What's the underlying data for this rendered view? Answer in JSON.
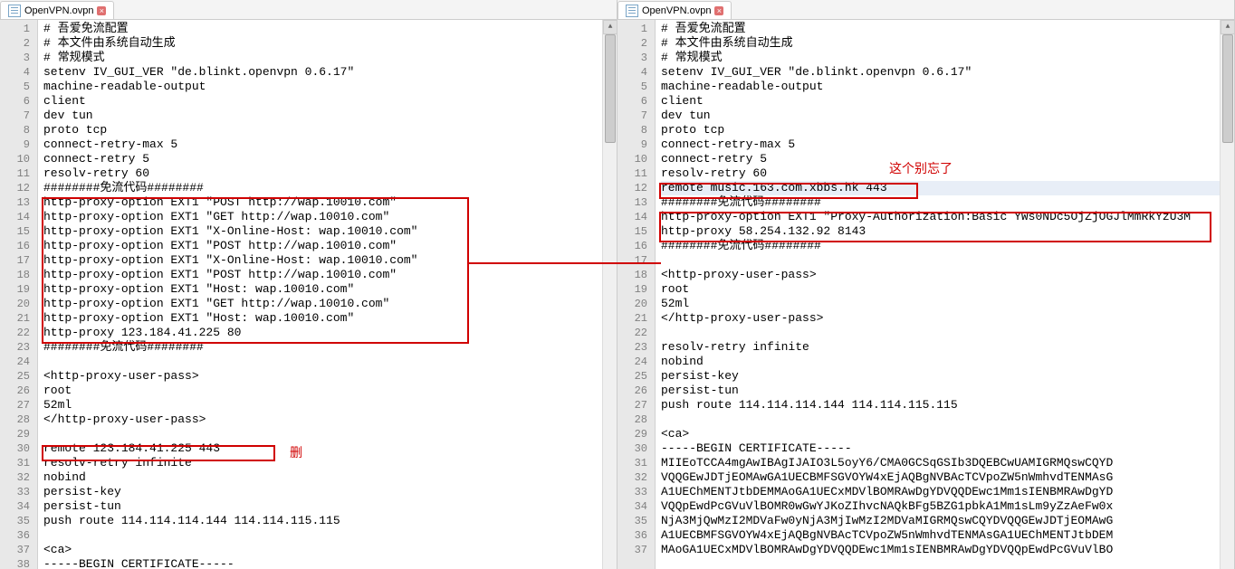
{
  "left": {
    "tab_label": "OpenVPN.ovpn",
    "lines": [
      "# 吾爱免流配置",
      "# 本文件由系统自动生成",
      "# 常规模式",
      "setenv IV_GUI_VER \"de.blinkt.openvpn 0.6.17\"",
      "machine-readable-output",
      "client",
      "dev tun",
      "proto tcp",
      "connect-retry-max 5",
      "connect-retry 5",
      "resolv-retry 60",
      "########免流代码########",
      "http-proxy-option EXT1 \"POST http://wap.10010.com\"",
      "http-proxy-option EXT1 \"GET http://wap.10010.com\"",
      "http-proxy-option EXT1 \"X-Online-Host: wap.10010.com\"",
      "http-proxy-option EXT1 \"POST http://wap.10010.com\"",
      "http-proxy-option EXT1 \"X-Online-Host: wap.10010.com\"",
      "http-proxy-option EXT1 \"POST http://wap.10010.com\"",
      "http-proxy-option EXT1 \"Host: wap.10010.com\"",
      "http-proxy-option EXT1 \"GET http://wap.10010.com\"",
      "http-proxy-option EXT1 \"Host: wap.10010.com\"",
      "http-proxy 123.184.41.225 80",
      "########免流代码########",
      "",
      "<http-proxy-user-pass>",
      "root",
      "52ml",
      "</http-proxy-user-pass>",
      "",
      "remote 123.184.41.225 443",
      "resolv-retry infinite",
      "nobind",
      "persist-key",
      "persist-tun",
      "push route 114.114.114.144 114.114.115.115",
      "",
      "<ca>",
      "-----BEGIN CERTIFICATE-----"
    ],
    "annotation_delete": "删"
  },
  "right": {
    "tab_label": "OpenVPN.ovpn",
    "lines": [
      "# 吾爱免流配置",
      "# 本文件由系统自动生成",
      "# 常规模式",
      "setenv IV_GUI_VER \"de.blinkt.openvpn 0.6.17\"",
      "machine-readable-output",
      "client",
      "dev tun",
      "proto tcp",
      "connect-retry-max 5",
      "connect-retry 5",
      "resolv-retry 60",
      "remote music.163.com.xbbs.hk 443",
      "########免流代码########",
      "http-proxy-option EXT1 \"Proxy-Authorization:Basic YWs0NDc5OjZjOGJlMmRkYzU3M",
      "http-proxy 58.254.132.92 8143",
      "########免流代码########",
      "",
      "<http-proxy-user-pass>",
      "root",
      "52ml",
      "</http-proxy-user-pass>",
      "",
      "resolv-retry infinite",
      "nobind",
      "persist-key",
      "persist-tun",
      "push route 114.114.114.144 114.114.115.115",
      "",
      "<ca>",
      "-----BEGIN CERTIFICATE-----",
      "MIIEoTCCA4mgAwIBAgIJAIO3L5oyY6/CMA0GCSqGSIb3DQEBCwUAMIGRMQswCQYD",
      "VQQGEwJDTjEOMAwGA1UECBMFSGVOYW4xEjAQBgNVBAcTCVpoZW5nWmhvdTENMAsG",
      "A1UEChMENTJtbDEMMAoGA1UECxMDVlBOMRAwDgYDVQQDEwc1Mm1sIENBMRAwDgYD",
      "VQQpEwdPcGVuVlBOMR0wGwYJKoZIhvcNAQkBFg5BZG1pbkA1Mm1sLm9yZzAeFw0x",
      "NjA3MjQwMzI2MDVaFw0yNjA3MjIwMzI2MDVaMIGRMQswCQYDVQQGEwJDTjEOMAwG",
      "A1UECBMFSGVOYW4xEjAQBgNVBAcTCVpoZW5nWmhvdTENMAsGA1UEChMENTJtbDEM",
      "MAoGA1UECxMDVlBOMRAwDgYDVQQDEwc1Mm1sIENBMRAwDgYDVQQpEwdPcGVuVlBO"
    ],
    "annotation_remind": "这个别忘了"
  }
}
